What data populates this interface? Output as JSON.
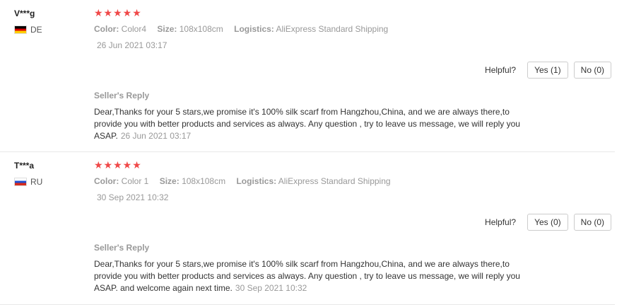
{
  "reviews": [
    {
      "user": "V***g",
      "country": "DE",
      "stars": "★★★★★",
      "color_label": "Color:",
      "color_value": "Color4",
      "size_label": "Size:",
      "size_value": "108x108cm",
      "logistics_label": "Logistics:",
      "logistics_value": "AliExpress Standard Shipping",
      "date": "26 Jun 2021 03:17",
      "helpful_label": "Helpful?",
      "yes": "Yes (1)",
      "no": "No (0)",
      "reply_title": "Seller's Reply",
      "reply_text": "Dear,Thanks for your 5 stars,we promise it's 100% silk scarf from Hangzhou,China, and we are always there,to provide you with better products and services as always. Any question , try to leave us message, we will reply you ASAP.",
      "reply_date": "26 Jun 2021 03:17"
    },
    {
      "user": "T***a",
      "country": "RU",
      "stars": "★★★★★",
      "color_label": "Color:",
      "color_value": "Color 1",
      "size_label": "Size:",
      "size_value": "108x108cm",
      "logistics_label": "Logistics:",
      "logistics_value": "AliExpress Standard Shipping",
      "date": "30 Sep 2021 10:32",
      "helpful_label": "Helpful?",
      "yes": "Yes (0)",
      "no": "No (0)",
      "reply_title": "Seller's Reply",
      "reply_text": "Dear,Thanks for your 5 stars,we promise it's 100% silk scarf from Hangzhou,China, and we are always there,to provide you with better products and services as always. Any question , try to leave us message, we will reply you ASAP. and welcome again next time.",
      "reply_date": "30 Sep 2021 10:32"
    }
  ],
  "colors": {
    "star": "#f04848",
    "muted": "#999999",
    "border": "#e8e8e8"
  }
}
